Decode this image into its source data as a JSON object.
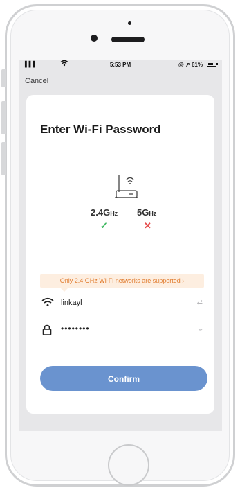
{
  "status_bar": {
    "signal": "▐▐▐",
    "wifi": "wifi-icon",
    "time": "5:53 PM",
    "right_text": "@ ↗ 61%"
  },
  "nav": {
    "cancel_label": "Cancel"
  },
  "page": {
    "title": "Enter Wi-Fi Password",
    "band_24_main": "2.4G",
    "band_24_unit": "Hz",
    "band_5_main": "5G",
    "band_5_unit": "Hz",
    "band_24_mark": "✓",
    "band_5_mark": "✕",
    "notice": "Only 2.4 GHz Wi-Fi networks are supported ›"
  },
  "form": {
    "ssid_value": "linkayl",
    "password_value": "••••••••",
    "switch_network_icon": "⇄",
    "show_password_icon": "⌣"
  },
  "actions": {
    "confirm_label": "Confirm"
  },
  "colors": {
    "accent": "#6a93cf",
    "notice_bg": "#fdeee0",
    "notice_text": "#e07a2c",
    "check": "#3bb75e",
    "cross": "#e54a4a"
  }
}
